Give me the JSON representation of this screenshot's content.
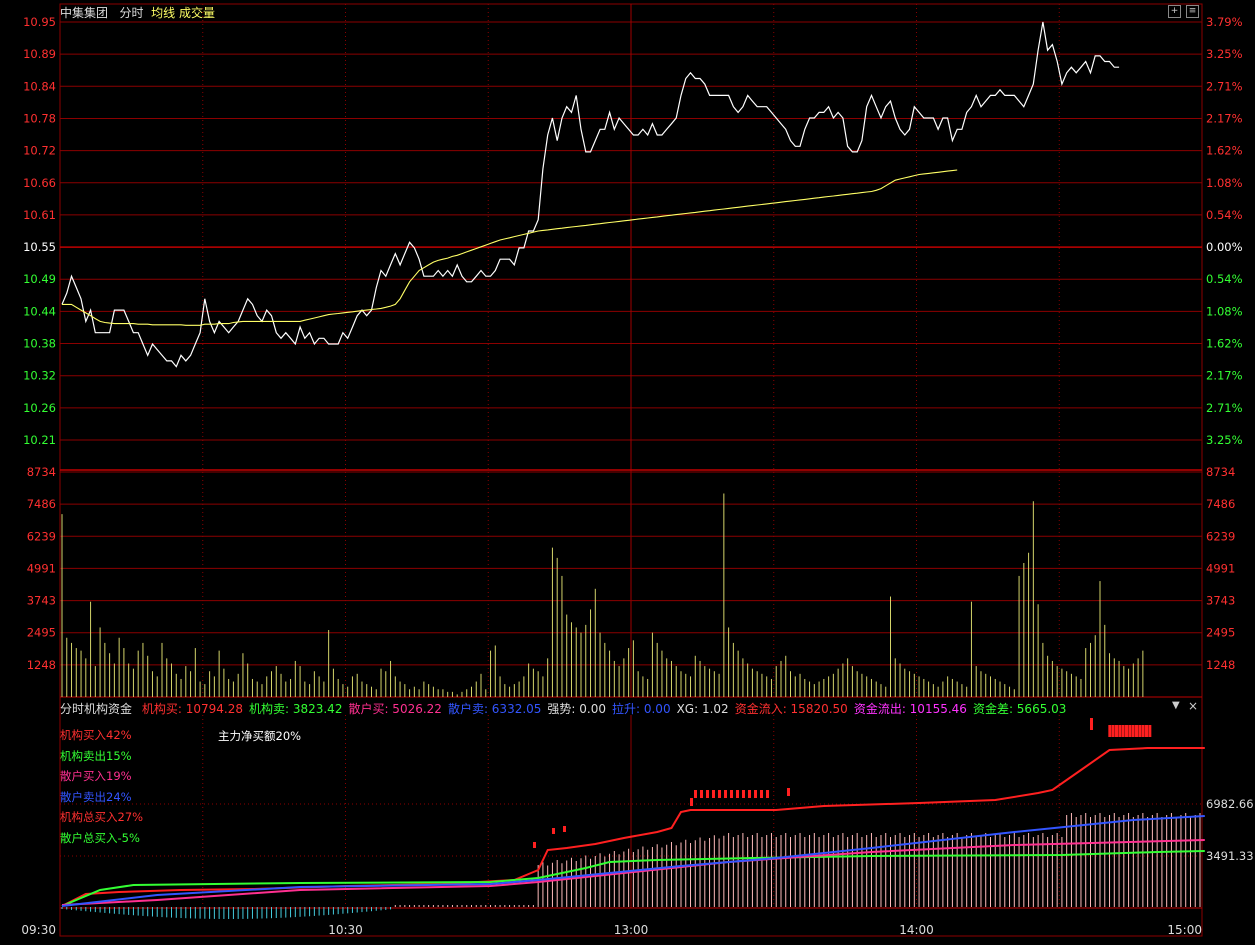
{
  "header": {
    "stock_name": "中集集团",
    "mode": "分时",
    "avg_label": "均线",
    "vol_label": "成交量"
  },
  "indicator_header": {
    "name": "分时机构资金",
    "items": [
      {
        "label": "机构买:",
        "value": "10794.28",
        "color": "#ff3030"
      },
      {
        "label": "机构卖:",
        "value": "3823.42",
        "color": "#33ff33"
      },
      {
        "label": "散户买:",
        "value": "5026.22",
        "color": "#ff3090"
      },
      {
        "label": "散户卖:",
        "value": "6332.05",
        "color": "#3355ff"
      },
      {
        "label": "强势:",
        "value": "0.00",
        "color": "#dddddd"
      },
      {
        "label": "拉升:",
        "value": "0.00",
        "color": "#3355ff"
      },
      {
        "label": "XG:",
        "value": "1.02",
        "color": "#dddddd"
      },
      {
        "label": "资金流入:",
        "value": "15820.50",
        "color": "#ff3030"
      },
      {
        "label": "资金流出:",
        "value": "10155.46",
        "color": "#ff33ff"
      },
      {
        "label": "资金差:",
        "value": "5665.03",
        "color": "#33ff33"
      }
    ]
  },
  "indicator_legend": [
    {
      "text": "机构买入42%",
      "color": "#ff3030"
    },
    {
      "text": "机构卖出15%",
      "color": "#33ff33"
    },
    {
      "text": "散户买入19%",
      "color": "#ff3090"
    },
    {
      "text": "散户卖出24%",
      "color": "#3355ff"
    },
    {
      "text": "机构总买入27%",
      "color": "#ff3030"
    },
    {
      "text": "散户总买入-5%",
      "color": "#33ff33"
    }
  ],
  "indicator_note": "主力净买额20%",
  "indicator_axis": [
    "6982.66",
    "3491.33"
  ],
  "time_labels": [
    "09:30",
    "10:30",
    "13:00",
    "14:00",
    "15:00"
  ],
  "colors": {
    "up": "#ff3030",
    "down": "#33ff33",
    "neutral": "#ffffff",
    "grid": "#8b0000",
    "price_line": "#ffffff",
    "avg_line": "#ffff66",
    "volume": "#d4d46a"
  },
  "chart_data": [
    {
      "type": "line",
      "title": "中集集团 分时",
      "prev_close": 10.55,
      "y_ticks": [
        "10.95",
        "10.89",
        "10.84",
        "10.78",
        "10.72",
        "10.66",
        "10.61",
        "10.55",
        "10.49",
        "10.44",
        "10.38",
        "10.32",
        "10.26",
        "10.21"
      ],
      "pct_ticks": [
        "3.79%",
        "3.25%",
        "2.71%",
        "2.17%",
        "1.62%",
        "1.08%",
        "0.54%",
        "0.00%",
        "0.54%",
        "1.08%",
        "1.62%",
        "2.17%",
        "2.71%",
        "3.25%"
      ],
      "ylim": [
        10.21,
        10.95
      ],
      "x_range": [
        "09:30",
        "15:00"
      ],
      "series": [
        {
          "name": "分时",
          "values": [
            10.45,
            10.47,
            10.5,
            10.48,
            10.46,
            10.42,
            10.44,
            10.4,
            10.4,
            10.4,
            10.4,
            10.44,
            10.44,
            10.44,
            10.42,
            10.4,
            10.4,
            10.38,
            10.36,
            10.38,
            10.37,
            10.36,
            10.35,
            10.35,
            10.34,
            10.36,
            10.35,
            10.36,
            10.38,
            10.4,
            10.46,
            10.42,
            10.4,
            10.42,
            10.41,
            10.4,
            10.41,
            10.42,
            10.44,
            10.46,
            10.45,
            10.43,
            10.42,
            10.44,
            10.43,
            10.4,
            10.39,
            10.4,
            10.39,
            10.38,
            10.41,
            10.39,
            10.4,
            10.38,
            10.39,
            10.39,
            10.38,
            10.38,
            10.38,
            10.4,
            10.39,
            10.41,
            10.43,
            10.44,
            10.43,
            10.44,
            10.48,
            10.51,
            10.5,
            10.52,
            10.54,
            10.52,
            10.54,
            10.56,
            10.55,
            10.53,
            10.5,
            10.5,
            10.5,
            10.51,
            10.5,
            10.51,
            10.5,
            10.52,
            10.5,
            10.49,
            10.49,
            10.5,
            10.51,
            10.5,
            10.5,
            10.51,
            10.53,
            10.53,
            10.53,
            10.52,
            10.55,
            10.55,
            10.58,
            10.58,
            10.6,
            10.69,
            10.75,
            10.78,
            10.74,
            10.78,
            10.8,
            10.79,
            10.82,
            10.76,
            10.72,
            10.72,
            10.74,
            10.76,
            10.76,
            10.79,
            10.76,
            10.78,
            10.77,
            10.76,
            10.75,
            10.75,
            10.76,
            10.75,
            10.77,
            10.75,
            10.75,
            10.76,
            10.77,
            10.78,
            10.82,
            10.85,
            10.86,
            10.85,
            10.85,
            10.84,
            10.82,
            10.82,
            10.82,
            10.82,
            10.82,
            10.8,
            10.79,
            10.8,
            10.82,
            10.81,
            10.8,
            10.8,
            10.8,
            10.79,
            10.78,
            10.77,
            10.76,
            10.74,
            10.73,
            10.73,
            10.76,
            10.78,
            10.78,
            10.79,
            10.79,
            10.8,
            10.78,
            10.79,
            10.78,
            10.73,
            10.72,
            10.72,
            10.74,
            10.8,
            10.82,
            10.8,
            10.78,
            10.8,
            10.81,
            10.78,
            10.76,
            10.75,
            10.76,
            10.8,
            10.79,
            10.78,
            10.78,
            10.78,
            10.76,
            10.78,
            10.78,
            10.74,
            10.76,
            10.76,
            10.79,
            10.8,
            10.82,
            10.8,
            10.81,
            10.82,
            10.82,
            10.83,
            10.82,
            10.82,
            10.82,
            10.81,
            10.8,
            10.82,
            10.84,
            10.9,
            10.95,
            10.9,
            10.91,
            10.88,
            10.84,
            10.86,
            10.87,
            10.86,
            10.87,
            10.88,
            10.86,
            10.89,
            10.89,
            10.88,
            10.88,
            10.87,
            10.87
          ]
        },
        {
          "name": "均线",
          "values": [
            10.45,
            10.45,
            10.45,
            10.445,
            10.44,
            10.435,
            10.43,
            10.425,
            10.42,
            10.418,
            10.417,
            10.416,
            10.416,
            10.416,
            10.416,
            10.416,
            10.415,
            10.415,
            10.415,
            10.414,
            10.414,
            10.414,
            10.414,
            10.414,
            10.414,
            10.414,
            10.413,
            10.413,
            10.413,
            10.413,
            10.415,
            10.415,
            10.415,
            10.416,
            10.416,
            10.416,
            10.418,
            10.419,
            10.42,
            10.42,
            10.42,
            10.42,
            10.42,
            10.42,
            10.42,
            10.42,
            10.42,
            10.42,
            10.42,
            10.42,
            10.42,
            10.422,
            10.424,
            10.426,
            10.428,
            10.43,
            10.432,
            10.433,
            10.434,
            10.435,
            10.436,
            10.437,
            10.438,
            10.439,
            10.44,
            10.441,
            10.442,
            10.443,
            10.445,
            10.447,
            10.45,
            10.46,
            10.475,
            10.49,
            10.5,
            10.51,
            10.515,
            10.52,
            10.525,
            10.528,
            10.53,
            10.532,
            10.535,
            10.537,
            10.54,
            10.543,
            10.546,
            10.549,
            10.552,
            10.555,
            10.558,
            10.561,
            10.564,
            10.566,
            10.568,
            10.57,
            10.572,
            10.574,
            10.576,
            10.578,
            10.58,
            10.581,
            10.582,
            10.583,
            10.584,
            10.585,
            10.586,
            10.587,
            10.588,
            10.589,
            10.59,
            10.591,
            10.592,
            10.593,
            10.594,
            10.595,
            10.596,
            10.597,
            10.598,
            10.599,
            10.6,
            10.601,
            10.602,
            10.603,
            10.604,
            10.605,
            10.606,
            10.607,
            10.608,
            10.609,
            10.61,
            10.611,
            10.612,
            10.613,
            10.614,
            10.615,
            10.616,
            10.617,
            10.618,
            10.619,
            10.62,
            10.621,
            10.622,
            10.623,
            10.624,
            10.625,
            10.626,
            10.627,
            10.628,
            10.629,
            10.63,
            10.631,
            10.632,
            10.633,
            10.634,
            10.635,
            10.636,
            10.637,
            10.638,
            10.639,
            10.64,
            10.641,
            10.642,
            10.643,
            10.644,
            10.645,
            10.646,
            10.647,
            10.648,
            10.649,
            10.65,
            10.652,
            10.655,
            10.66,
            10.665,
            10.67,
            10.672,
            10.674,
            10.676,
            10.678,
            10.68,
            10.681,
            10.682,
            10.683,
            10.684,
            10.685,
            10.686,
            10.687,
            10.688
          ]
        }
      ]
    },
    {
      "type": "bar",
      "title": "成交量",
      "y_ticks": [
        "8734",
        "7486",
        "6239",
        "4991",
        "3743",
        "2495",
        "1248"
      ],
      "ylim": [
        0,
        8734
      ],
      "values": [
        7100,
        2300,
        2100,
        1900,
        1800,
        1500,
        3700,
        1200,
        2700,
        2100,
        1700,
        1300,
        2300,
        1900,
        1300,
        1100,
        1800,
        2100,
        1600,
        1000,
        800,
        2100,
        1500,
        1300,
        900,
        700,
        1200,
        1000,
        1900,
        600,
        500,
        1000,
        800,
        1800,
        1100,
        700,
        600,
        900,
        1700,
        1300,
        700,
        600,
        500,
        800,
        1000,
        1200,
        900,
        600,
        700,
        1400,
        1200,
        600,
        500,
        1000,
        800,
        600,
        2600,
        1100,
        700,
        500,
        400,
        800,
        900,
        600,
        500,
        400,
        300,
        1100,
        1000,
        1400,
        800,
        600,
        500,
        300,
        400,
        300,
        600,
        500,
        400,
        300,
        300,
        200,
        200,
        100,
        200,
        300,
        400,
        600,
        900,
        300,
        1800,
        2000,
        800,
        500,
        400,
        500,
        600,
        800,
        1300,
        1100,
        1000,
        800,
        1500,
        5800,
        5400,
        4700,
        3200,
        2900,
        2700,
        2500,
        2800,
        3400,
        4200,
        2500,
        2100,
        1800,
        1400,
        1200,
        1500,
        1900,
        2200,
        1000,
        800,
        700,
        2500,
        2100,
        1800,
        1500,
        1400,
        1200,
        1000,
        900,
        800,
        1600,
        1400,
        1200,
        1100,
        1000,
        900,
        7900,
        2700,
        2100,
        1800,
        1500,
        1300,
        1100,
        1000,
        900,
        800,
        700,
        1200,
        1400,
        1600,
        1000,
        800,
        900,
        700,
        600,
        500,
        600,
        700,
        800,
        900,
        1100,
        1300,
        1500,
        1200,
        1000,
        900,
        800,
        700,
        600,
        500,
        400,
        3900,
        1500,
        1300,
        1100,
        1000,
        900,
        800,
        700,
        600,
        500,
        400,
        600,
        800,
        700,
        600,
        500,
        400,
        3700,
        1200,
        1000,
        900,
        800,
        700,
        600,
        500,
        400,
        300,
        4700,
        5200,
        5600,
        7600,
        3600,
        2100,
        1600,
        1400,
        1200,
        1100,
        1000,
        900,
        800,
        700,
        1900,
        2100,
        2400,
        4500,
        2800,
        1700,
        1500,
        1400,
        1200,
        1100,
        1300,
        1500,
        1800
      ]
    },
    {
      "type": "line",
      "title": "分时机构资金",
      "y_ticks": [
        "6982.66",
        "3491.33"
      ],
      "series": [
        {
          "name": "机构买入42%",
          "values": [
            0,
            100,
            200,
            400,
            500,
            600,
            700,
            800,
            900,
            1000,
            1100,
            1200,
            1300,
            1400,
            1500,
            1600,
            1700,
            1800,
            1900,
            2000,
            2100,
            2200,
            2300,
            2400,
            2500,
            2600,
            2700,
            2800,
            2900,
            3000,
            3100,
            3200,
            3300,
            3400,
            3500,
            3600,
            3700,
            3800,
            3900,
            4000,
            4100,
            4200,
            4300,
            4400,
            4500,
            4600,
            4700,
            4800,
            4900,
            5000,
            5100,
            5200,
            5300,
            5400,
            5500,
            5600,
            5700,
            5800,
            5900,
            6000,
            6100,
            6200,
            6300,
            6400,
            6500,
            6600,
            6700,
            6800,
            6900,
            7000,
            7100,
            7200,
            7300,
            7400,
            7500,
            7600,
            7700,
            7800,
            7900,
            8000,
            8100,
            8200,
            8300,
            8400,
            8500,
            8600,
            8700,
            8800,
            8900,
            9000,
            9100,
            9200,
            9300,
            9400,
            9500,
            9600,
            9700,
            9800,
            9900,
            10000,
            10100,
            10200,
            10300,
            10400,
            10500,
            10600,
            10700,
            10794
          ]
        },
        {
          "name": "机构卖出15%",
          "values": [
            0,
            100,
            200,
            300,
            400,
            500,
            600,
            700,
            800,
            900,
            1000,
            1100,
            1200,
            1300,
            1400,
            1500,
            1600,
            1700,
            1800,
            1900,
            2000,
            2100,
            2200,
            2300,
            2400,
            2500,
            2600,
            2700,
            2800,
            2900,
            3000,
            3100,
            3200,
            3300,
            3400,
            3500,
            3600,
            3700,
            3823
          ]
        },
        {
          "name": "散户买入19%",
          "values": [
            0,
            200,
            400,
            600,
            800,
            1000,
            1200,
            1400,
            1600,
            1800,
            2000,
            2200,
            2400,
            2600,
            2800,
            3000,
            3200,
            3400,
            3600,
            3800,
            4000,
            4200,
            4400,
            4600,
            4800,
            5026
          ]
        },
        {
          "name": "散户卖出24%",
          "values": [
            0,
            300,
            600,
            900,
            1200,
            1500,
            1800,
            2100,
            2400,
            2700,
            3000,
            3300,
            3600,
            3900,
            4200,
            4500,
            4800,
            5100,
            5400,
            5700,
            6000,
            6332
          ]
        }
      ]
    }
  ]
}
